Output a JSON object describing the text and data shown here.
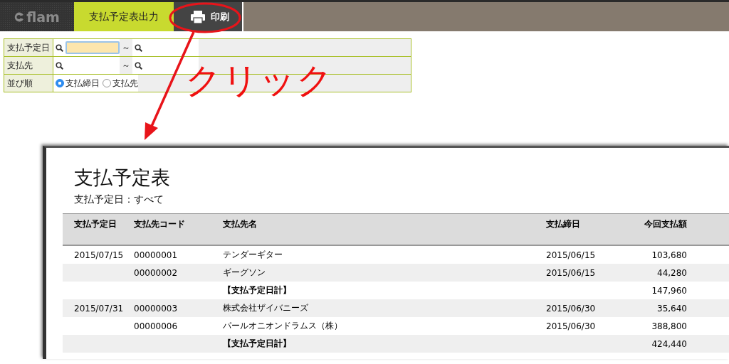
{
  "app": {
    "logo": "flam"
  },
  "tabs": [
    {
      "kind": "tab",
      "label": "支払予定表出力",
      "selected": true
    },
    {
      "kind": "print",
      "label": "印刷",
      "selected": false
    }
  ],
  "filters": [
    {
      "kind": "range",
      "label": "支払予定日",
      "focused": true,
      "separator": "～"
    },
    {
      "kind": "range",
      "label": "支払先",
      "focused": false,
      "separator": "～"
    },
    {
      "kind": "radio",
      "label": "並び順",
      "options": [
        {
          "label": "支払締日",
          "selected": true
        },
        {
          "label": "支払先",
          "selected": false
        }
      ]
    }
  ],
  "annotation": {
    "text": "クリック"
  },
  "report": {
    "title": "支払予定表",
    "subtitle": "支払予定日：すべて",
    "columns": [
      "支払予定日",
      "支払先コード",
      "支払先名",
      "支払締日",
      "今回支払額"
    ],
    "rows": [
      {
        "kind": "detail",
        "date": "2015/07/15",
        "code": "00000001",
        "name": "テンダーギター",
        "closing": "2015/06/15",
        "amount": "103,680"
      },
      {
        "kind": "detail",
        "code": "00000002",
        "name": "ギーグソン",
        "closing": "2015/06/15",
        "amount": "44,280"
      },
      {
        "kind": "subtotal",
        "name": "【支払予定日計】",
        "amount": "147,960"
      },
      {
        "kind": "detail",
        "date": "2015/07/31",
        "code": "00000003",
        "name": "株式会社ザイバニーズ",
        "closing": "2015/06/30",
        "amount": "35,640"
      },
      {
        "kind": "detail",
        "code": "00000006",
        "name": "パールオニオンドラムス（株）",
        "closing": "2015/06/30",
        "amount": "388,800"
      },
      {
        "kind": "subtotal",
        "name": "【支払予定日計】",
        "amount": "424,440"
      }
    ]
  }
}
